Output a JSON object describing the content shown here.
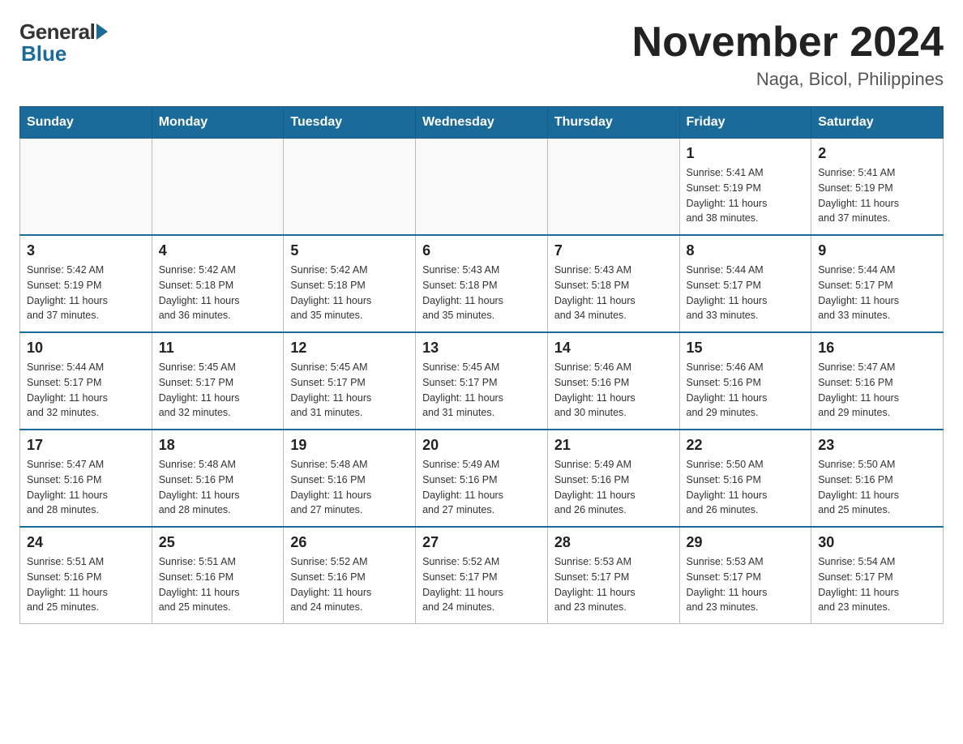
{
  "header": {
    "logo_general": "General",
    "logo_blue": "Blue",
    "month_title": "November 2024",
    "location": "Naga, Bicol, Philippines"
  },
  "days_of_week": [
    "Sunday",
    "Monday",
    "Tuesday",
    "Wednesday",
    "Thursday",
    "Friday",
    "Saturday"
  ],
  "weeks": [
    [
      {
        "day": "",
        "info": ""
      },
      {
        "day": "",
        "info": ""
      },
      {
        "day": "",
        "info": ""
      },
      {
        "day": "",
        "info": ""
      },
      {
        "day": "",
        "info": ""
      },
      {
        "day": "1",
        "info": "Sunrise: 5:41 AM\nSunset: 5:19 PM\nDaylight: 11 hours\nand 38 minutes."
      },
      {
        "day": "2",
        "info": "Sunrise: 5:41 AM\nSunset: 5:19 PM\nDaylight: 11 hours\nand 37 minutes."
      }
    ],
    [
      {
        "day": "3",
        "info": "Sunrise: 5:42 AM\nSunset: 5:19 PM\nDaylight: 11 hours\nand 37 minutes."
      },
      {
        "day": "4",
        "info": "Sunrise: 5:42 AM\nSunset: 5:18 PM\nDaylight: 11 hours\nand 36 minutes."
      },
      {
        "day": "5",
        "info": "Sunrise: 5:42 AM\nSunset: 5:18 PM\nDaylight: 11 hours\nand 35 minutes."
      },
      {
        "day": "6",
        "info": "Sunrise: 5:43 AM\nSunset: 5:18 PM\nDaylight: 11 hours\nand 35 minutes."
      },
      {
        "day": "7",
        "info": "Sunrise: 5:43 AM\nSunset: 5:18 PM\nDaylight: 11 hours\nand 34 minutes."
      },
      {
        "day": "8",
        "info": "Sunrise: 5:44 AM\nSunset: 5:17 PM\nDaylight: 11 hours\nand 33 minutes."
      },
      {
        "day": "9",
        "info": "Sunrise: 5:44 AM\nSunset: 5:17 PM\nDaylight: 11 hours\nand 33 minutes."
      }
    ],
    [
      {
        "day": "10",
        "info": "Sunrise: 5:44 AM\nSunset: 5:17 PM\nDaylight: 11 hours\nand 32 minutes."
      },
      {
        "day": "11",
        "info": "Sunrise: 5:45 AM\nSunset: 5:17 PM\nDaylight: 11 hours\nand 32 minutes."
      },
      {
        "day": "12",
        "info": "Sunrise: 5:45 AM\nSunset: 5:17 PM\nDaylight: 11 hours\nand 31 minutes."
      },
      {
        "day": "13",
        "info": "Sunrise: 5:45 AM\nSunset: 5:17 PM\nDaylight: 11 hours\nand 31 minutes."
      },
      {
        "day": "14",
        "info": "Sunrise: 5:46 AM\nSunset: 5:16 PM\nDaylight: 11 hours\nand 30 minutes."
      },
      {
        "day": "15",
        "info": "Sunrise: 5:46 AM\nSunset: 5:16 PM\nDaylight: 11 hours\nand 29 minutes."
      },
      {
        "day": "16",
        "info": "Sunrise: 5:47 AM\nSunset: 5:16 PM\nDaylight: 11 hours\nand 29 minutes."
      }
    ],
    [
      {
        "day": "17",
        "info": "Sunrise: 5:47 AM\nSunset: 5:16 PM\nDaylight: 11 hours\nand 28 minutes."
      },
      {
        "day": "18",
        "info": "Sunrise: 5:48 AM\nSunset: 5:16 PM\nDaylight: 11 hours\nand 28 minutes."
      },
      {
        "day": "19",
        "info": "Sunrise: 5:48 AM\nSunset: 5:16 PM\nDaylight: 11 hours\nand 27 minutes."
      },
      {
        "day": "20",
        "info": "Sunrise: 5:49 AM\nSunset: 5:16 PM\nDaylight: 11 hours\nand 27 minutes."
      },
      {
        "day": "21",
        "info": "Sunrise: 5:49 AM\nSunset: 5:16 PM\nDaylight: 11 hours\nand 26 minutes."
      },
      {
        "day": "22",
        "info": "Sunrise: 5:50 AM\nSunset: 5:16 PM\nDaylight: 11 hours\nand 26 minutes."
      },
      {
        "day": "23",
        "info": "Sunrise: 5:50 AM\nSunset: 5:16 PM\nDaylight: 11 hours\nand 25 minutes."
      }
    ],
    [
      {
        "day": "24",
        "info": "Sunrise: 5:51 AM\nSunset: 5:16 PM\nDaylight: 11 hours\nand 25 minutes."
      },
      {
        "day": "25",
        "info": "Sunrise: 5:51 AM\nSunset: 5:16 PM\nDaylight: 11 hours\nand 25 minutes."
      },
      {
        "day": "26",
        "info": "Sunrise: 5:52 AM\nSunset: 5:16 PM\nDaylight: 11 hours\nand 24 minutes."
      },
      {
        "day": "27",
        "info": "Sunrise: 5:52 AM\nSunset: 5:17 PM\nDaylight: 11 hours\nand 24 minutes."
      },
      {
        "day": "28",
        "info": "Sunrise: 5:53 AM\nSunset: 5:17 PM\nDaylight: 11 hours\nand 23 minutes."
      },
      {
        "day": "29",
        "info": "Sunrise: 5:53 AM\nSunset: 5:17 PM\nDaylight: 11 hours\nand 23 minutes."
      },
      {
        "day": "30",
        "info": "Sunrise: 5:54 AM\nSunset: 5:17 PM\nDaylight: 11 hours\nand 23 minutes."
      }
    ]
  ]
}
